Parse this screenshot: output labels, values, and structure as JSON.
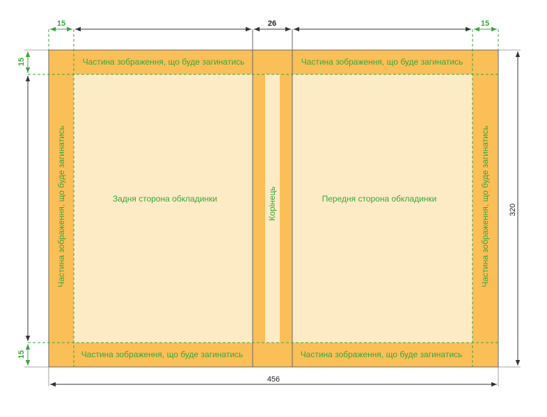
{
  "colors": {
    "fold_area": "#fbbf58",
    "panel": "#fdebc6",
    "guide": "#3aa63a",
    "outline": "#666666",
    "dimension": "#333333"
  },
  "labels": {
    "fold_text": "Частина зображення, що буде загинатись",
    "back_cover": "Задня сторона обкладинки",
    "front_cover": "Передня сторона обкладинки",
    "spine": "Корінець"
  },
  "dimensions": {
    "left_margin": "15",
    "spine_width": "26",
    "right_margin": "15",
    "top_margin": "15",
    "bottom_margin": "15",
    "total_width": "456",
    "total_height": "320"
  }
}
